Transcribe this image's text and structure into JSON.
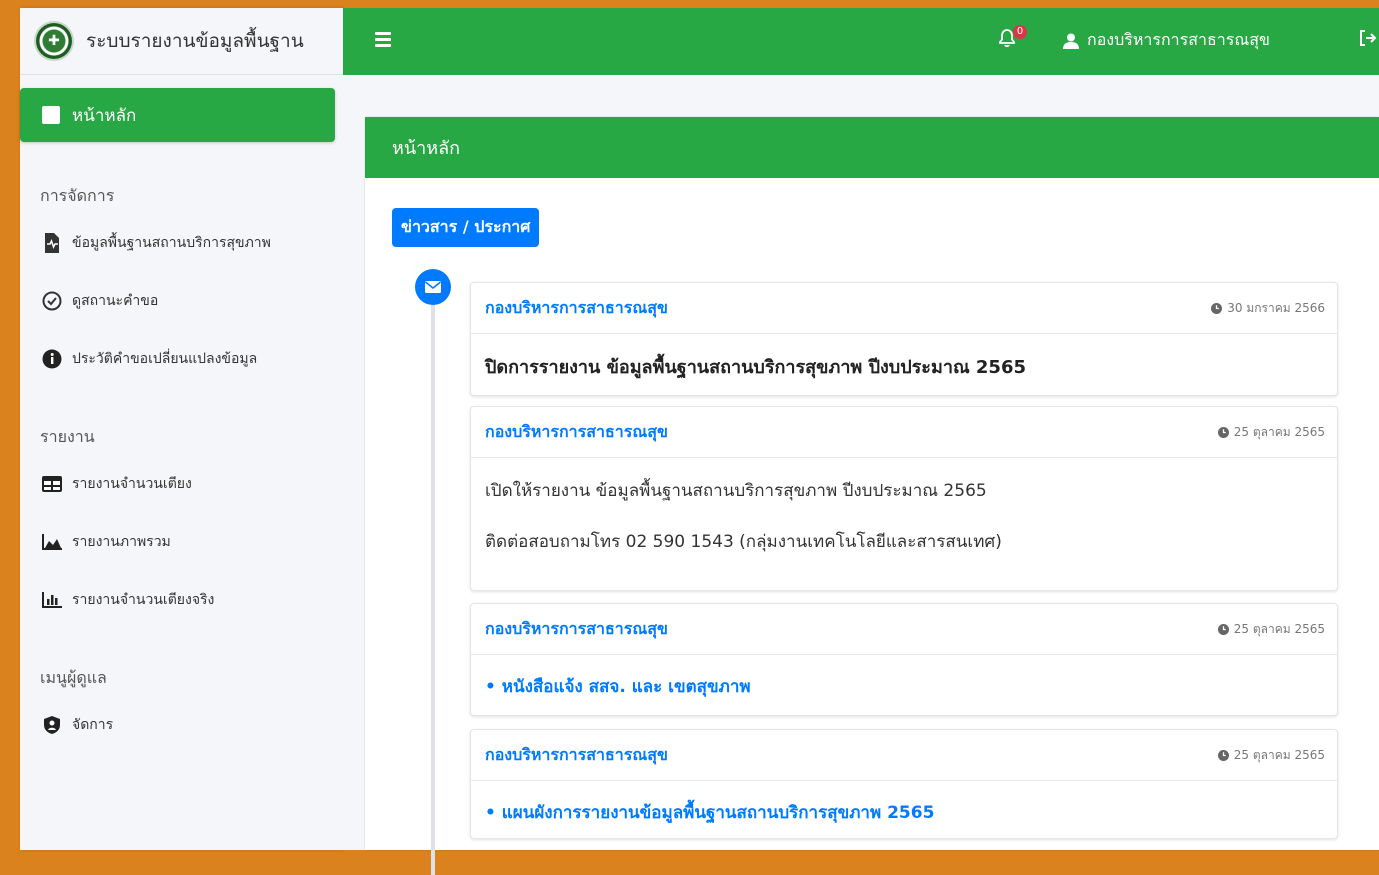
{
  "brand": {
    "title": "ระบบรายงานข้อมูลพื้นฐาน"
  },
  "sidebar": {
    "home_label": "หน้าหลัก",
    "sections": [
      {
        "header": "การจัดการ",
        "items": [
          {
            "label": "ข้อมูลพื้นฐานสถานบริการสุขภาพ",
            "icon": "file-medical-icon"
          },
          {
            "label": "ดูสถานะคำขอ",
            "icon": "check-circle-icon"
          },
          {
            "label": "ประวัติคำขอเปลี่ยนแปลงข้อมูล",
            "icon": "info-circle-icon"
          }
        ]
      },
      {
        "header": "รายงาน",
        "items": [
          {
            "label": "รายงานจำนวนเตียง",
            "icon": "table-icon"
          },
          {
            "label": "รายงานภาพรวม",
            "icon": "area-chart-icon"
          },
          {
            "label": "รายงานจำนวนเตียงจริง",
            "icon": "bar-chart-icon"
          }
        ]
      },
      {
        "header": "เมนูผู้ดูแล",
        "items": [
          {
            "label": "จัดการ",
            "icon": "user-shield-icon"
          }
        ]
      }
    ]
  },
  "topbar": {
    "notification_count": "0",
    "user_name": "กองบริหารการสาธารณสุข"
  },
  "page": {
    "card_title": "หน้าหลัก",
    "news_label": "ข่าวสาร / ประกาศ"
  },
  "news": [
    {
      "author": "กองบริหารการสาธารณสุข",
      "date": "30 มกราคม 2566",
      "lines": [
        "ปิดการรายงาน ข้อมูลพื้นฐานสถานบริการสุขภาพ ปีงบประมาณ 2565"
      ]
    },
    {
      "author": "กองบริหารการสาธารณสุข",
      "date": "25 ตุลาคม 2565",
      "lines": [
        "เปิดให้รายงาน ข้อมูลพื้นฐานสถานบริการสุขภาพ ปีงบประมาณ 2565",
        "ติดต่อสอบถามโทร 02 590 1543 (กลุ่มงานเทคโนโลยีและสารสนเทศ)"
      ]
    },
    {
      "author": "กองบริหารการสาธารณสุข",
      "date": "25 ตุลาคม 2565",
      "lines": [
        "• หนังสือแจ้ง สสจ. และ เขตสุขภาพ"
      ]
    },
    {
      "author": "กองบริหารการสาธารณสุข",
      "date": "25 ตุลาคม 2565",
      "lines": [
        "• แผนผังการรายงานข้อมูลพื้นฐานสถานบริการสุขภาพ 2565"
      ]
    }
  ],
  "colors": {
    "accent": "#28a745",
    "primary": "#007bff",
    "frame": "#d9821e"
  }
}
